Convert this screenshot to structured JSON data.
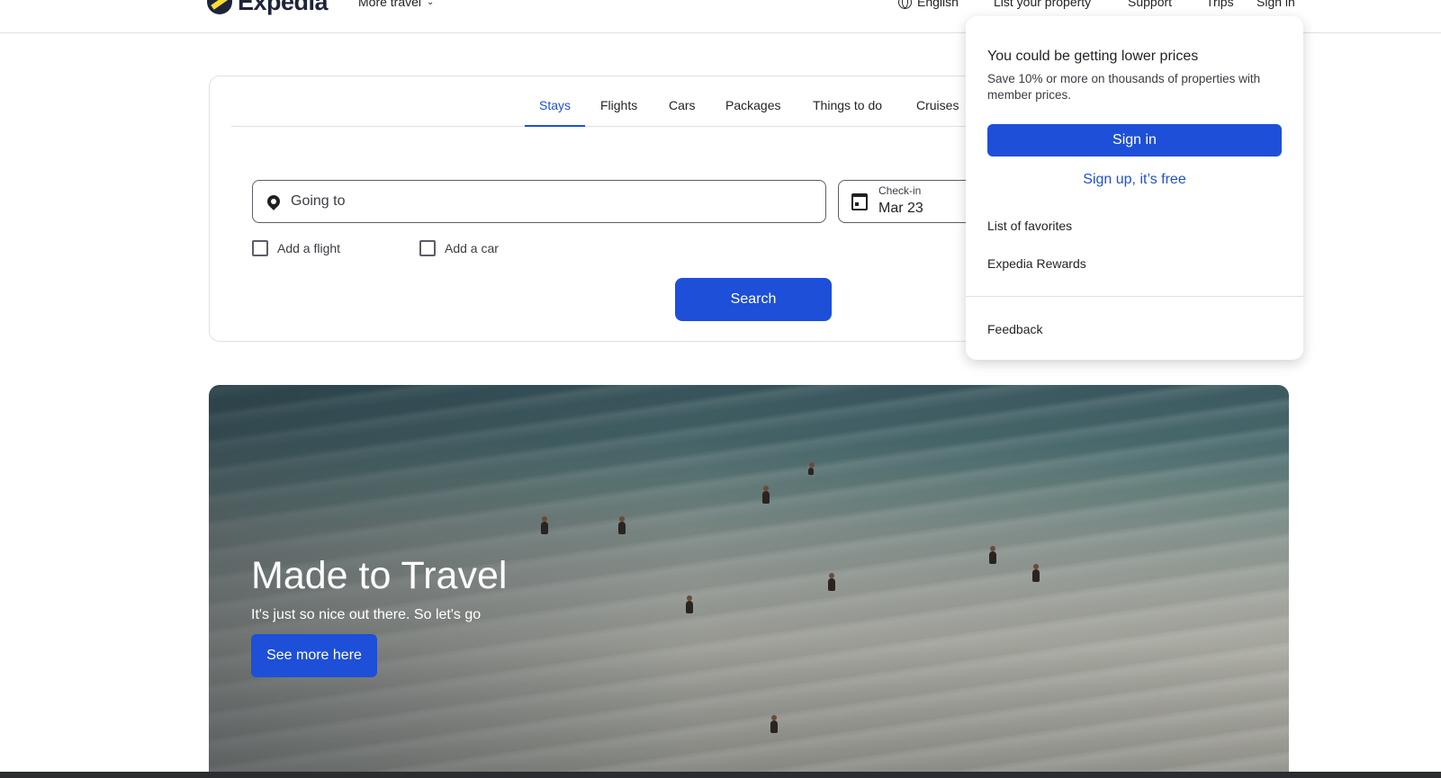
{
  "header": {
    "logo_text": "Expedia",
    "more_travel": "More travel",
    "language": "English",
    "list_property": "List your property",
    "support": "Support",
    "trips": "Trips",
    "sign_in": "Sign in"
  },
  "search": {
    "tabs": [
      {
        "label": "Stays",
        "active": true
      },
      {
        "label": "Flights",
        "active": false
      },
      {
        "label": "Cars",
        "active": false
      },
      {
        "label": "Packages",
        "active": false
      },
      {
        "label": "Things to do",
        "active": false
      },
      {
        "label": "Cruises",
        "active": false
      }
    ],
    "going_to_placeholder": "Going to",
    "checkin_label": "Check-in",
    "checkin_value": "Mar 23",
    "add_flight": "Add a flight",
    "add_car": "Add a car",
    "search_button": "Search"
  },
  "hero": {
    "title": "Made to Travel",
    "subtitle": "It's just so nice out there. So let's go",
    "button": "See more here"
  },
  "dropdown": {
    "title": "You could be getting lower prices",
    "description": "Save 10% or more on thousands of properties with member prices.",
    "sign_in": "Sign in",
    "sign_up": "Sign up, it’s free",
    "favorites": "List of favorites",
    "rewards": "Expedia Rewards",
    "feedback": "Feedback"
  },
  "colors": {
    "primary": "#1e4fd8",
    "text": "#1f2124",
    "border": "#dfe0e4"
  }
}
